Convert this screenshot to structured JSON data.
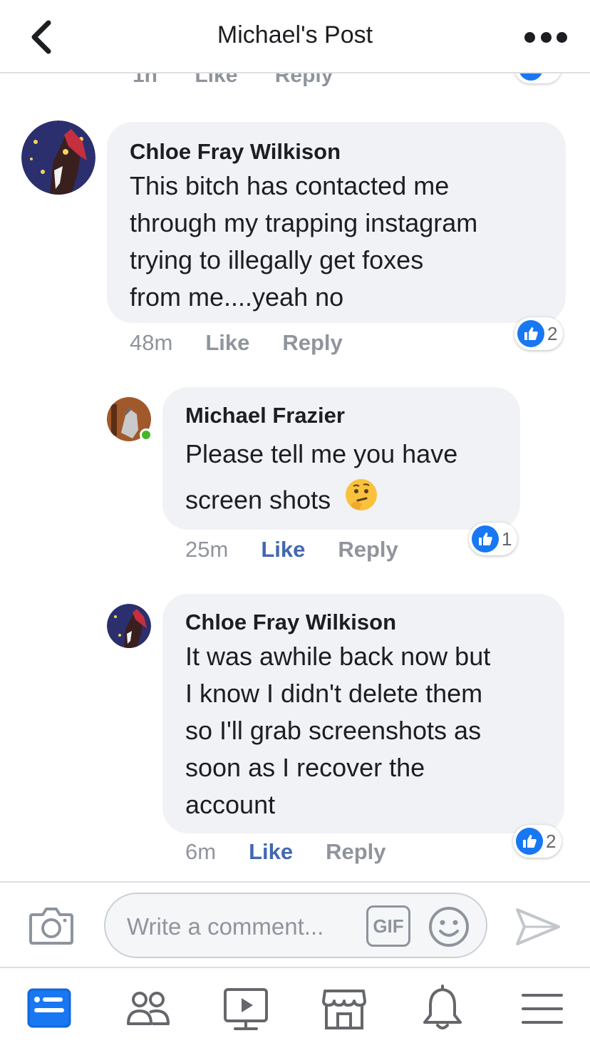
{
  "header": {
    "title": "Michael's Post"
  },
  "previous_comment": {
    "time": "1h",
    "like_label": "Like",
    "reply_label": "Reply"
  },
  "comments": [
    {
      "author": "Chloe Fray Wilkison",
      "lines": [
        "This bitch has contacted me",
        "through my trapping instagram",
        "trying to illegally get foxes",
        "from me....yeah no"
      ],
      "time": "48m",
      "like_label": "Like",
      "reply_label": "Reply",
      "like_active": false,
      "reaction_count": "2"
    },
    {
      "author": "Michael Frazier",
      "lines": [
        "Please tell me you have",
        "screen shots"
      ],
      "emoji": "🤔",
      "time": "25m",
      "like_label": "Like",
      "reply_label": "Reply",
      "like_active": true,
      "reaction_count": "1",
      "online": true
    },
    {
      "author": "Chloe Fray Wilkison",
      "lines": [
        "It was awhile back now but",
        "I know I didn't delete them",
        "so I'll grab screenshots as",
        "soon as I recover the",
        "account"
      ],
      "time": "6m",
      "like_label": "Like",
      "reply_label": "Reply",
      "like_active": true,
      "reaction_count": "2"
    }
  ],
  "composer": {
    "placeholder": "Write a comment...",
    "gif_label": "GIF"
  },
  "tabbar": {
    "items": [
      "news-feed-icon",
      "friends-icon",
      "watch-icon",
      "marketplace-icon",
      "notifications-icon",
      "menu-icon"
    ]
  },
  "colors": {
    "accent": "#4267b2",
    "reaction_blue": "#1877f2",
    "bubble": "#f0f2f5",
    "muted": "#90949c",
    "online": "#42b72a"
  }
}
